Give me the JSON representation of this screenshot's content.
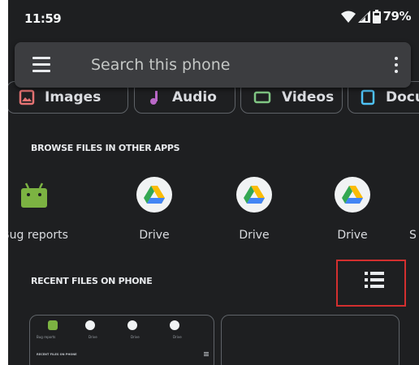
{
  "status_bar": {
    "time": "11:59",
    "battery": "79%"
  },
  "search": {
    "placeholder": "Search this phone"
  },
  "categories": [
    {
      "label": "Images",
      "icon": "image-icon",
      "color": "#e57373"
    },
    {
      "label": "Audio",
      "icon": "music-note-icon",
      "color": "#ba68c8"
    },
    {
      "label": "Videos",
      "icon": "video-icon",
      "color": "#81c784"
    },
    {
      "label": "Documents",
      "icon": "document-icon",
      "color": "#4fc3f7"
    }
  ],
  "browse_section": {
    "title": "BROWSE FILES IN OTHER APPS",
    "apps": [
      {
        "label": "Bug reports",
        "icon": "android-icon"
      },
      {
        "label": "Drive",
        "icon": "google-drive-icon"
      },
      {
        "label": "Drive",
        "icon": "google-drive-icon"
      },
      {
        "label": "Drive",
        "icon": "google-drive-icon"
      },
      {
        "label": "S",
        "icon": "app-icon"
      }
    ]
  },
  "recent_section": {
    "title": "RECENT FILES ON PHONE",
    "toggle_icon": "list-view-icon",
    "thumbnail": {
      "labels": [
        "Bug reports",
        "Drive",
        "Drive",
        "Drive"
      ],
      "header": "RECENT FILES ON PHONE"
    }
  },
  "colors": {
    "background": "#1e1f21",
    "search_bar": "#3c3d40",
    "highlight": "#d32f2f",
    "android_green": "#7cb342"
  }
}
